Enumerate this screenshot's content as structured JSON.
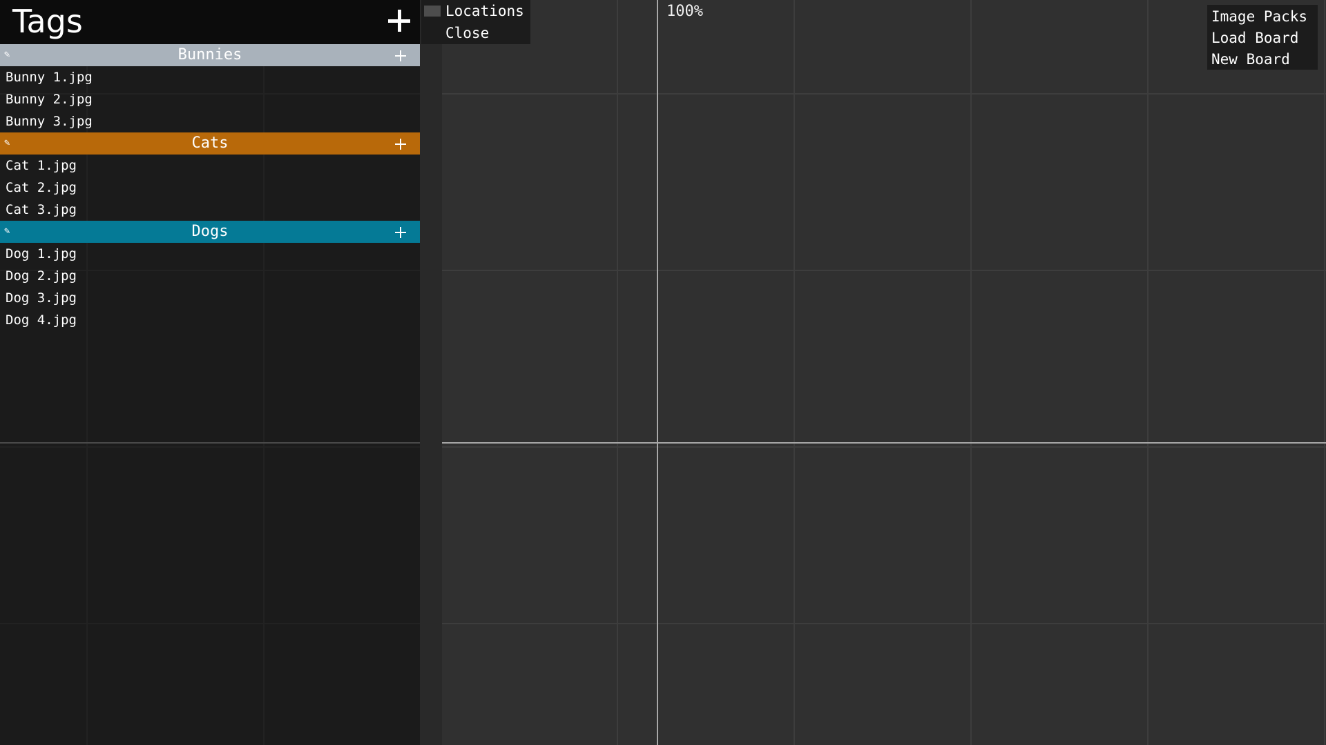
{
  "sidebar": {
    "title": "Tags",
    "tags": [
      {
        "name": "Bunnies",
        "color": "#a9b2bb",
        "files": [
          "Bunny 1.jpg",
          "Bunny 2.jpg",
          "Bunny 3.jpg"
        ]
      },
      {
        "name": "Cats",
        "color": "#b8690a",
        "files": [
          "Cat 1.jpg",
          "Cat 2.jpg",
          "Cat 3.jpg"
        ]
      },
      {
        "name": "Dogs",
        "color": "#057a96",
        "files": [
          "Dog 1.jpg",
          "Dog 2.jpg",
          "Dog 3.jpg",
          "Dog 4.jpg"
        ]
      }
    ]
  },
  "locations_menu": {
    "items": [
      "Locations",
      "Close"
    ]
  },
  "board": {
    "zoom": "100%"
  },
  "main_menu": {
    "items": [
      "Image Packs",
      "Load Board",
      "New Board"
    ]
  },
  "icons": {
    "edit": "pencil-icon",
    "add": "plus-icon"
  }
}
